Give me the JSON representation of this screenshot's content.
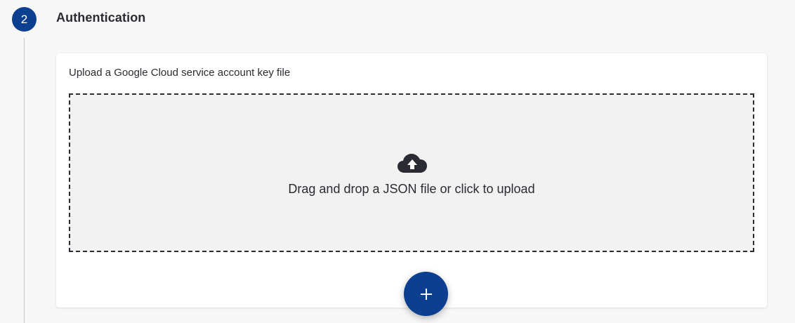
{
  "step": {
    "number": "2",
    "title": "Authentication"
  },
  "upload": {
    "label": "Upload a Google Cloud service account key file",
    "dropzone_text": "Drag and drop a JSON file or click to upload",
    "dropzone_icon": "cloud-upload-icon",
    "add_button_icon": "plus-icon"
  },
  "colors": {
    "accent": "#0c3f8f",
    "text": "#2b2b33",
    "dropzone_bg": "#f2f2f2"
  }
}
